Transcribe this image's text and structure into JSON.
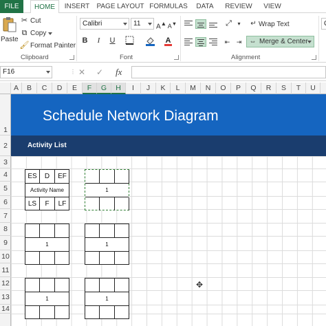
{
  "tabs": [
    "FILE",
    "HOME",
    "INSERT",
    "PAGE LAYOUT",
    "FORMULAS",
    "DATA",
    "REVIEW",
    "VIEW"
  ],
  "clipboard": {
    "paste": "Paste",
    "cut": "Cut",
    "copy": "Copy",
    "format_painter": "Format Painter",
    "group_label": "Clipboard"
  },
  "font": {
    "name": "Calibri",
    "size": "11",
    "bold": "B",
    "italic": "I",
    "underline": "U",
    "group_label": "Font"
  },
  "alignment": {
    "wrap_text": "Wrap Text",
    "merge_center": "Merge & Center",
    "group_label": "Alignment"
  },
  "number": {
    "format": "Ge"
  },
  "formula_bar": {
    "name_box": "F16",
    "fx": "fx",
    "cancel": "✕",
    "enter": "✓"
  },
  "columns": [
    "A",
    "B",
    "C",
    "D",
    "E",
    "F",
    "G",
    "H",
    "I",
    "J",
    "K",
    "L",
    "M",
    "N",
    "O",
    "P",
    "Q",
    "R",
    "S",
    "T",
    "U"
  ],
  "selected_columns": [
    "F",
    "G",
    "H"
  ],
  "rows": [
    "1",
    "2",
    "3",
    "4",
    "5",
    "6",
    "7",
    "8",
    "9",
    "10",
    "11",
    "12",
    "13",
    "14"
  ],
  "sheet": {
    "title": "Schedule Network Diagram",
    "subtitle": "Activity List"
  },
  "legend_node": {
    "es": "ES",
    "d": "D",
    "ef": "EF",
    "name": "Activity Name",
    "ls": "LS",
    "f": "F",
    "lf": "LF"
  },
  "nodes": [
    {
      "label": "1"
    },
    {
      "label": "1"
    },
    {
      "label": "1"
    },
    {
      "label": "1"
    },
    {
      "label": "1"
    }
  ],
  "colors": {
    "excel_green": "#217346",
    "banner_blue": "#1565c0",
    "subbar_navy": "#1a3d6e"
  }
}
